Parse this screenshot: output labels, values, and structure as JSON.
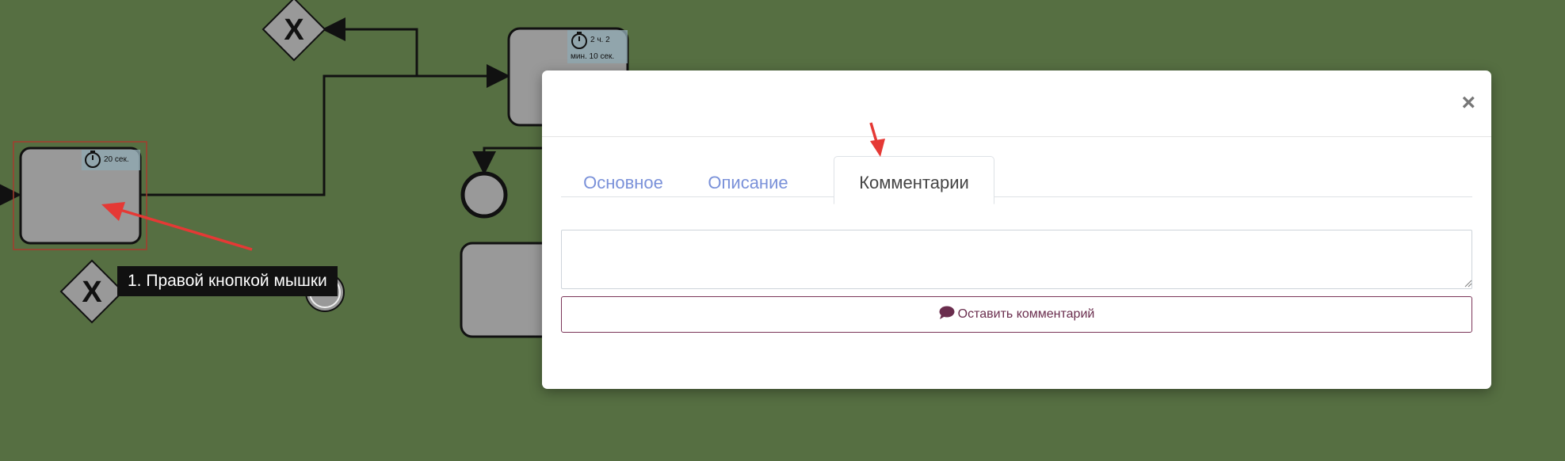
{
  "diagram": {
    "timers": {
      "task_upper_line1": "2 ч. 2",
      "task_upper_line2": "мин. 10 сек.",
      "task_left": "20 сек."
    },
    "gateway_symbol": "X"
  },
  "callout": {
    "text": "1. Правой кнопкой мышки"
  },
  "modal": {
    "tabs": [
      {
        "label": "Основное"
      },
      {
        "label": "Описание"
      },
      {
        "label": "Комментарии"
      }
    ],
    "comment_value": "",
    "submit_label": "Оставить комментарий"
  },
  "colors": {
    "background": "#566f42",
    "tab_link": "#7a91d9",
    "button_accent": "#7b3558",
    "annotation_arrow": "#e53935"
  },
  "icons": [
    "close-icon",
    "timer-icon",
    "comment-icon",
    "resize-grip-icon"
  ]
}
